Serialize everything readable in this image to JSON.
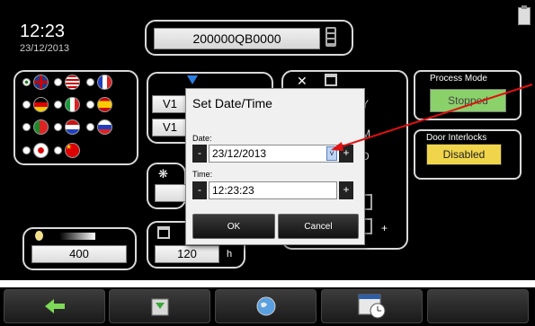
{
  "clock": {
    "time": "12:23",
    "date": "23/12/2013"
  },
  "serial": {
    "value": "200000QB0000"
  },
  "languages": [
    "uk-flag",
    "us-flag",
    "france-flag",
    "germany-flag",
    "italy-flag",
    "spain-flag",
    "portugal-flag",
    "netherlands-flag",
    "russia-flag",
    "japan-flag",
    "china-flag"
  ],
  "partial_fields": {
    "v1": "V1",
    "v2": "V1",
    "y": "Y",
    "m": "M",
    "d": "D",
    "plus": "+"
  },
  "brightness": {
    "value": "400"
  },
  "timer": {
    "value": "120",
    "unit": "h"
  },
  "process_mode": {
    "label": "Process Mode",
    "value": "Stopped",
    "color": "#8bd16a"
  },
  "door_interlocks": {
    "label": "Door Interlocks",
    "value": "Disabled",
    "color": "#f0d54a"
  },
  "dialog": {
    "title": "Set Date/Time",
    "date_label": "Date:",
    "date_value": "23/12/2013",
    "time_label": "Time:",
    "time_value": "12:23:23",
    "minus": "-",
    "plus": "+",
    "ok": "OK",
    "cancel": "Cancel"
  },
  "nav": [
    "back-arrow-icon",
    "save-icon",
    "globe-icon",
    "calendar-clock-icon",
    "empty"
  ]
}
